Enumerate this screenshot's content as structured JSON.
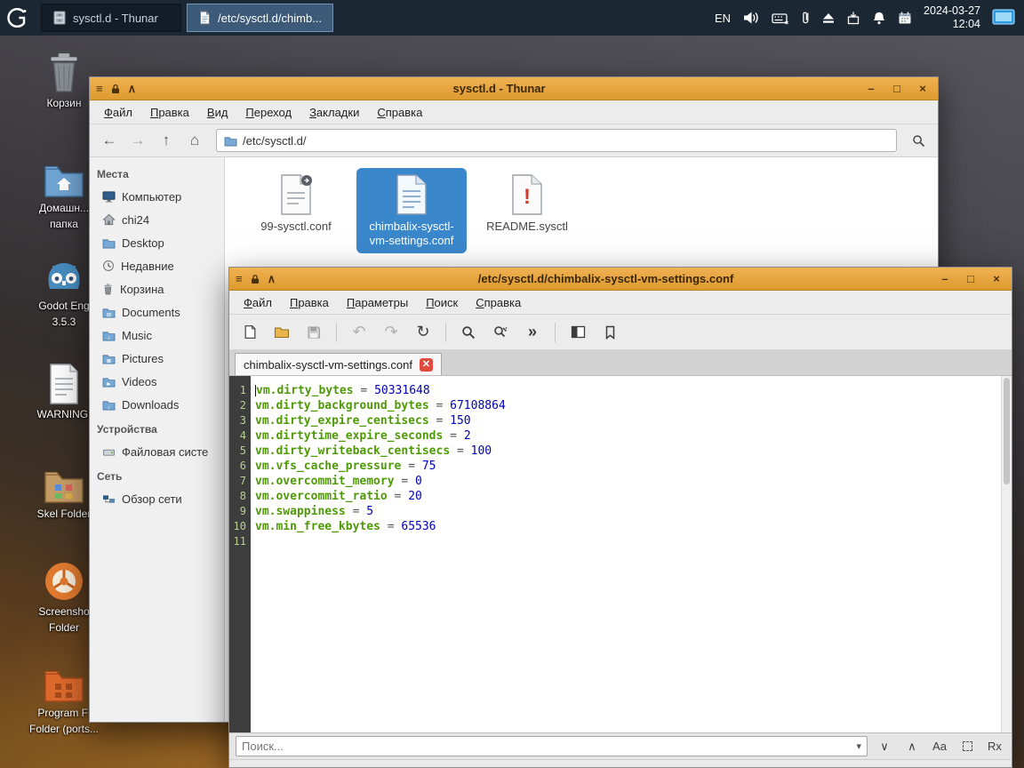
{
  "panel": {
    "taskbar": [
      {
        "title": "sysctl.d - Thunar"
      },
      {
        "title": "/etc/sysctl.d/chimb..."
      }
    ],
    "tray": {
      "language": "EN",
      "date": "2024-03-27",
      "time": "12:04"
    }
  },
  "desktop": {
    "icons": [
      {
        "line1": "Корзин",
        "line2": ""
      },
      {
        "line1": "Домашн...",
        "line2": "папка"
      },
      {
        "line1": "Godot Eng",
        "line2": "3.5.3"
      },
      {
        "line1": "WARNING!",
        "line2": ""
      },
      {
        "line1": "Skel Folder",
        "line2": ""
      },
      {
        "line1": "Screensho",
        "line2": "Folder"
      },
      {
        "line1": "Program Fi",
        "line2": "Folder (ports..."
      }
    ]
  },
  "thunar": {
    "title": "sysctl.d - Thunar",
    "menu": [
      "Файл",
      "Правка",
      "Вид",
      "Переход",
      "Закладки",
      "Справка"
    ],
    "path": "/etc/sysctl.d/",
    "sidebar": {
      "places_header": "Места",
      "places": [
        "Компьютер",
        "chi24",
        "Desktop",
        "Недавние",
        "Корзина",
        "Documents",
        "Music",
        "Pictures",
        "Videos",
        "Downloads"
      ],
      "devices_header": "Устройства",
      "devices": [
        "Файловая систе"
      ],
      "network_header": "Сеть",
      "network": [
        "Обзор сети"
      ]
    },
    "files": [
      {
        "line1": "99-sysctl.conf",
        "line2": ""
      },
      {
        "line1": "chimbalix-sysctl-",
        "line2": "vm-settings.conf"
      },
      {
        "line1": "README.sysctl",
        "line2": ""
      }
    ]
  },
  "editor": {
    "title": "/etc/sysctl.d/chimbalix-sysctl-vm-settings.conf",
    "menu": [
      "Файл",
      "Правка",
      "Параметры",
      "Поиск",
      "Справка"
    ],
    "tab": "chimbalix-sysctl-vm-settings.conf",
    "lines": [
      {
        "num": "1",
        "key": "vm.dirty_bytes",
        "sep": " = ",
        "value": "50331648"
      },
      {
        "num": "2",
        "key": "vm.dirty_background_bytes",
        "sep": " = ",
        "value": "67108864"
      },
      {
        "num": "3",
        "key": "vm.dirty_expire_centisecs",
        "sep": " = ",
        "value": "150"
      },
      {
        "num": "4",
        "key": "vm.dirtytime_expire_seconds",
        "sep": " = ",
        "value": "2"
      },
      {
        "num": "5",
        "key": "vm.dirty_writeback_centisecs",
        "sep": " = ",
        "value": "100"
      },
      {
        "num": "6",
        "key": "vm.vfs_cache_pressure",
        "sep": " = ",
        "value": "75"
      },
      {
        "num": "7",
        "key": "vm.overcommit_memory",
        "sep": " = ",
        "value": "0"
      },
      {
        "num": "8",
        "key": "vm.overcommit_ratio",
        "sep": " = ",
        "value": "20"
      },
      {
        "num": "9",
        "key": "vm.swappiness",
        "sep": " = ",
        "value": "5"
      },
      {
        "num": "10",
        "key": "vm.min_free_kbytes",
        "sep": " = ",
        "value": "65536"
      },
      {
        "num": "11",
        "key": "",
        "sep": "",
        "value": ""
      }
    ],
    "search": {
      "placeholder": "Поиск...",
      "match_case": "Aa",
      "regex": "Rx"
    }
  }
}
